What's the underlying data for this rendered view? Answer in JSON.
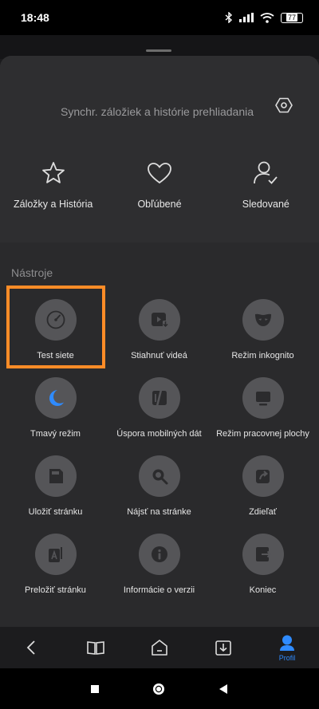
{
  "status": {
    "time": "18:48",
    "battery": "77"
  },
  "sync": {
    "text": "Synchr. záložiek a histórie prehliadania"
  },
  "quick": [
    {
      "label": "Záložky a História",
      "icon": "star-icon"
    },
    {
      "label": "Obľúbené",
      "icon": "heart-icon"
    },
    {
      "label": "Sledované",
      "icon": "user-check-icon"
    }
  ],
  "tools_title": "Nástroje",
  "tools": [
    {
      "label": "Test siete",
      "icon": "speedometer-icon"
    },
    {
      "label": "Stiahnuť videá",
      "icon": "video-download-icon"
    },
    {
      "label": "Režim inkognito",
      "icon": "mask-icon"
    },
    {
      "label": "Tmavý režim",
      "icon": "moon-icon"
    },
    {
      "label": "Úspora mobilných dát",
      "icon": "data-saver-icon"
    },
    {
      "label": "Režim pracovnej plochy",
      "icon": "desktop-icon"
    },
    {
      "label": "Uložiť stránku",
      "icon": "save-page-icon"
    },
    {
      "label": "Nájsť na stránke",
      "icon": "find-icon"
    },
    {
      "label": "Zdieľať",
      "icon": "share-icon"
    },
    {
      "label": "Preložiť stránku",
      "icon": "translate-icon"
    },
    {
      "label": "Informácie o verzii",
      "icon": "info-icon"
    },
    {
      "label": "Koniec",
      "icon": "exit-icon"
    }
  ],
  "nav": {
    "profile_label": "Profil"
  },
  "colors": {
    "accent": "#2f8bff",
    "highlight": "#ff8c27",
    "moon": "#2f8bff"
  }
}
